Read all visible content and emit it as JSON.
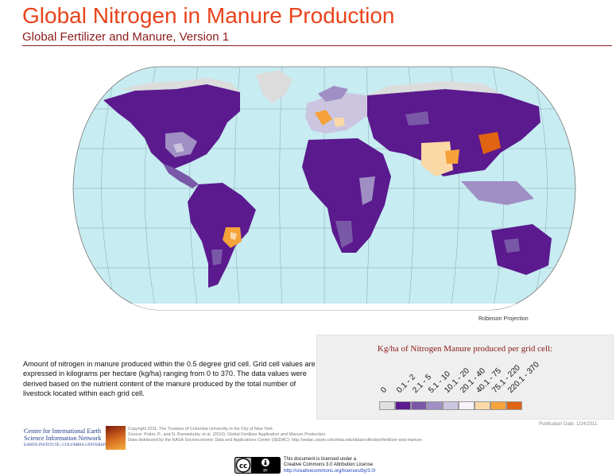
{
  "header": {
    "title": "Global Nitrogen in Manure Production",
    "subtitle": "Global Fertilizer and Manure, Version 1"
  },
  "map": {
    "projection_label": "Robinson Projection",
    "ocean_color": "#c7ecf2",
    "nodata_color": "#dcdcdc"
  },
  "legend": {
    "title": "Kg/ha of Nitrogen Manure produced per grid cell:",
    "classes": [
      {
        "label": "0",
        "color": "#e0e0e0"
      },
      {
        "label": "0.1 - 2",
        "color": "#5b1a8e"
      },
      {
        "label": "2.1 - 5",
        "color": "#7a58a8"
      },
      {
        "label": "5.1 - 10",
        "color": "#9f8fc4"
      },
      {
        "label": "10.1 - 20",
        "color": "#cbc5e0"
      },
      {
        "label": "20.1 - 40",
        "color": "#f6f2f7"
      },
      {
        "label": "40.1 - 75",
        "color": "#fad9a6"
      },
      {
        "label": "75.1 - 220",
        "color": "#f5a23a"
      },
      {
        "label": "220.1 - 370",
        "color": "#e06412"
      }
    ]
  },
  "description": "Amount of nitrogen in manure produced within the 0.5 degree grid cell.  Grid cell values are expressed in kilograms per hectare (kg/ha) ranging from 0 to 370. The data values were derived based on the nutrient content of the manure produced by the total number of livestock located within each grid cell.",
  "publication_date": "Publication Date: 1/24/2011",
  "organization": {
    "line1": "Center for International Earth",
    "line2": "Science Information Network",
    "line3": "EARTH INSTITUTE | COLUMBIA UNIVERSITY"
  },
  "credits": [
    "Copyright 2011. The Trustees of Columbia University in the City of New York.",
    "Source: Potter, P., and N. Ramankutty, et al. (2010). Global Fertilizer Application and Manure Production.",
    "Data distributed by the NASA Socioeconomic Data and Applications Center (SEDAC): http://sedac.ciesin.columbia.edu/data/collection/fertilizer-and-manure"
  ],
  "license": {
    "badge": "BY",
    "line1": "This document is licensed under a",
    "line2": "Creative Commons 3.0 Attribution License",
    "link": "http://creativecommons.org/licenses/by/3.0/"
  }
}
